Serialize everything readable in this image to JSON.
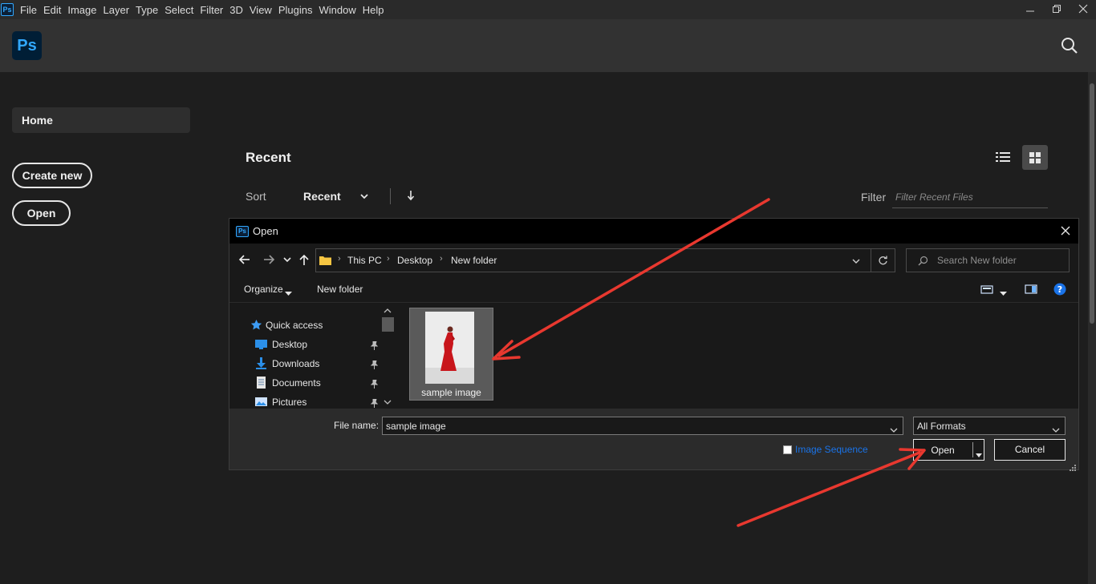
{
  "menu": {
    "items": [
      "File",
      "Edit",
      "Image",
      "Layer",
      "Type",
      "Select",
      "Filter",
      "3D",
      "View",
      "Plugins",
      "Window",
      "Help"
    ],
    "window_controls": [
      "minimize",
      "restore",
      "close"
    ]
  },
  "header": {
    "logo_text": "Ps",
    "search_icon": "search-icon"
  },
  "sidebar": {
    "home_label": "Home",
    "create_new_label": "Create new",
    "open_label": "Open"
  },
  "recent": {
    "title": "Recent",
    "sort_label": "Sort",
    "sort_value": "Recent",
    "filter_label": "Filter",
    "filter_placeholder": "Filter Recent Files"
  },
  "dialog": {
    "title": "Open",
    "breadcrumb": [
      "This PC",
      "Desktop",
      "New folder"
    ],
    "search_placeholder": "Search New folder",
    "organize_label": "Organize",
    "new_folder_label": "New folder",
    "nav_items": [
      {
        "label": "Quick access",
        "icon": "star-icon"
      },
      {
        "label": "Desktop",
        "icon": "desktop-icon"
      },
      {
        "label": "Downloads",
        "icon": "download-icon"
      },
      {
        "label": "Documents",
        "icon": "document-icon"
      },
      {
        "label": "Pictures",
        "icon": "pictures-icon"
      }
    ],
    "files": [
      {
        "label": "sample image"
      }
    ],
    "file_name_label": "File name:",
    "file_name_value": "sample image",
    "format_value": "All Formats",
    "image_sequence_label": "Image Sequence",
    "open_button": "Open",
    "cancel_button": "Cancel"
  },
  "colors": {
    "accent": "#31a8ff",
    "annotation": "#e8382f",
    "link": "#1a73e8"
  }
}
